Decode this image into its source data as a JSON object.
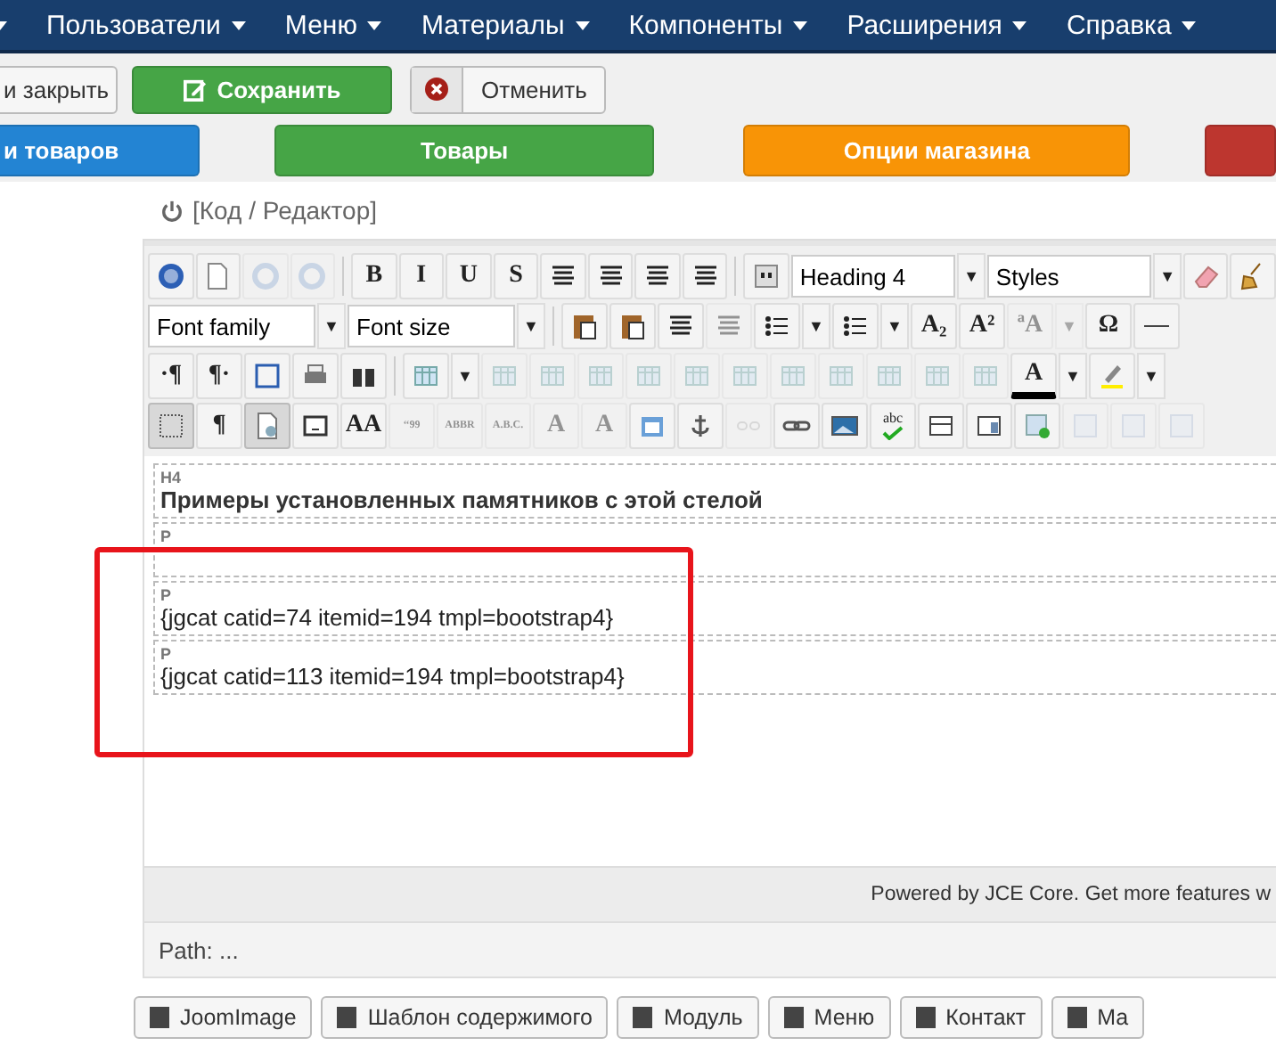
{
  "navbar": {
    "items": [
      {
        "has_menu": true
      },
      {
        "label": "Пользователи",
        "has_menu": true
      },
      {
        "label": "Меню",
        "has_menu": true
      },
      {
        "label": "Материалы",
        "has_menu": true
      },
      {
        "label": "Компоненты",
        "has_menu": true
      },
      {
        "label": "Расширения",
        "has_menu": true
      },
      {
        "label": "Справка",
        "has_menu": true
      }
    ]
  },
  "actions": [
    {
      "kind": "plain",
      "label": "и закрыть"
    },
    {
      "kind": "save",
      "label": "Сохранить"
    },
    {
      "kind": "cancel",
      "label": "Отменить"
    }
  ],
  "tabs": [
    {
      "label": "и товаров",
      "color": "#2384d3"
    },
    {
      "label": "Товары",
      "color": "#46a546"
    },
    {
      "label": "Опции магазина",
      "color": "#f89406"
    },
    {
      "color": "#bd362f"
    }
  ],
  "editor": {
    "toggle_label": "[Код / Редактор]",
    "toolbar": [
      [
        {
          "kind": "icon",
          "disabled": false,
          "pressed": false
        },
        {
          "kind": "icon",
          "disabled": false,
          "pressed": false
        },
        {
          "kind": "icon",
          "disabled": true,
          "pressed": false
        },
        {
          "kind": "icon",
          "disabled": true,
          "pressed": false
        },
        {
          "kind": "separator"
        },
        {
          "kind": "glyph",
          "text": "B",
          "disabled": false,
          "pressed": false
        },
        {
          "kind": "glyph",
          "text": "I",
          "disabled": false,
          "pressed": false
        },
        {
          "kind": "glyph",
          "text": "U",
          "disabled": false,
          "pressed": false
        },
        {
          "kind": "glyph",
          "text": "S",
          "disabled": false,
          "pressed": false
        },
        {
          "kind": "icon",
          "disabled": false,
          "pressed": false
        },
        {
          "kind": "icon",
          "disabled": false,
          "pressed": false
        },
        {
          "kind": "icon",
          "disabled": false,
          "pressed": false
        },
        {
          "kind": "icon",
          "disabled": false,
          "pressed": false
        },
        {
          "kind": "separator"
        },
        {
          "kind": "icon",
          "disabled": false,
          "pressed": false
        },
        {
          "kind": "select",
          "label": "Heading 4"
        },
        {
          "kind": "arrow",
          "text": "▼",
          "disabled": false
        },
        {
          "kind": "select",
          "label": "Styles"
        },
        {
          "kind": "arrow",
          "text": "▼",
          "disabled": false
        },
        {
          "kind": "icon",
          "disabled": false,
          "pressed": false
        },
        {
          "kind": "icon",
          "disabled": false,
          "pressed": false
        }
      ],
      [
        {
          "kind": "select",
          "label": "Font family"
        },
        {
          "kind": "arrow",
          "text": "▼",
          "disabled": false
        },
        {
          "kind": "select",
          "label": "Font size"
        },
        {
          "kind": "arrow",
          "text": "▼",
          "disabled": false
        },
        {
          "kind": "separator"
        },
        {
          "kind": "icon",
          "disabled": false,
          "pressed": false
        },
        {
          "kind": "icon",
          "disabled": false,
          "pressed": false
        },
        {
          "kind": "icon",
          "disabled": false,
          "pressed": false
        },
        {
          "kind": "icon",
          "disabled": true,
          "pressed": false
        },
        {
          "kind": "icon",
          "disabled": false,
          "pressed": false
        },
        {
          "kind": "arrow",
          "text": "▼",
          "disabled": false
        },
        {
          "kind": "icon",
          "disabled": false,
          "pressed": false
        },
        {
          "kind": "arrow",
          "text": "▼",
          "disabled": false
        },
        {
          "kind": "glyph",
          "text": "A₂",
          "disabled": false,
          "pressed": false
        },
        {
          "kind": "glyph",
          "text": "A²",
          "disabled": false,
          "pressed": false
        },
        {
          "kind": "glyph",
          "text": "ªA",
          "disabled": true,
          "pressed": false
        },
        {
          "kind": "arrow",
          "text": "▼",
          "disabled": true
        },
        {
          "kind": "glyph",
          "text": "Ω",
          "disabled": false,
          "pressed": false
        },
        {
          "kind": "icon",
          "disabled": false,
          "pressed": false
        }
      ],
      [
        {
          "kind": "glyph",
          "text": "·¶",
          "disabled": false,
          "pressed": false
        },
        {
          "kind": "glyph",
          "text": "¶·",
          "disabled": false,
          "pressed": false
        },
        {
          "kind": "icon",
          "disabled": false,
          "pressed": false
        },
        {
          "kind": "icon",
          "disabled": false,
          "pressed": false
        },
        {
          "kind": "icon",
          "disabled": false,
          "pressed": false
        },
        {
          "kind": "separator"
        },
        {
          "kind": "icon",
          "disabled": false,
          "pressed": false
        },
        {
          "kind": "arrow",
          "text": "▼",
          "disabled": false
        },
        {
          "kind": "icon",
          "disabled": true,
          "pressed": false
        },
        {
          "kind": "icon",
          "disabled": true,
          "pressed": false
        },
        {
          "kind": "icon",
          "disabled": true,
          "pressed": false
        },
        {
          "kind": "icon",
          "disabled": true,
          "pressed": false
        },
        {
          "kind": "icon",
          "disabled": true,
          "pressed": false
        },
        {
          "kind": "icon",
          "disabled": true,
          "pressed": false
        },
        {
          "kind": "icon",
          "disabled": true,
          "pressed": false
        },
        {
          "kind": "icon",
          "disabled": true,
          "pressed": false
        },
        {
          "kind": "icon",
          "disabled": true,
          "pressed": false
        },
        {
          "kind": "icon",
          "disabled": true,
          "pressed": false
        },
        {
          "kind": "icon",
          "disabled": true,
          "pressed": false
        },
        {
          "kind": "color-glyph",
          "text": "A",
          "color": "#000000",
          "disabled": false,
          "pressed": false
        },
        {
          "kind": "arrow",
          "text": "▼",
          "disabled": false
        },
        {
          "kind": "icon",
          "disabled": false,
          "pressed": false
        },
        {
          "kind": "arrow",
          "text": "▼",
          "disabled": false
        }
      ],
      [
        {
          "kind": "icon",
          "disabled": false,
          "pressed": true
        },
        {
          "kind": "glyph",
          "text": "¶",
          "disabled": false,
          "pressed": false
        },
        {
          "kind": "icon",
          "disabled": false,
          "pressed": true
        },
        {
          "kind": "icon",
          "disabled": false,
          "pressed": false
        },
        {
          "kind": "glyph",
          "text": "AA",
          "disabled": false,
          "pressed": false
        },
        {
          "kind": "glyph",
          "text": "‘‘99",
          "disabled": true,
          "pressed": false
        },
        {
          "kind": "glyph",
          "text": "ABBR",
          "disabled": true,
          "pressed": false
        },
        {
          "kind": "glyph",
          "text": "A.B.C.",
          "disabled": true,
          "pressed": false
        },
        {
          "kind": "glyph",
          "text": "A",
          "disabled": true,
          "pressed": false
        },
        {
          "kind": "glyph",
          "text": "A",
          "disabled": true,
          "pressed": false
        },
        {
          "kind": "icon",
          "disabled": false,
          "pressed": false
        },
        {
          "kind": "icon",
          "disabled": false,
          "pressed": false
        },
        {
          "kind": "icon",
          "disabled": true,
          "pressed": false
        },
        {
          "kind": "icon",
          "disabled": false,
          "pressed": false
        },
        {
          "kind": "icon",
          "disabled": false,
          "pressed": false
        },
        {
          "kind": "glyph-check",
          "text": "abc",
          "disabled": false,
          "pressed": false
        },
        {
          "kind": "icon",
          "disabled": false,
          "pressed": false
        },
        {
          "kind": "icon",
          "disabled": false,
          "pressed": false
        },
        {
          "kind": "icon",
          "disabled": false,
          "pressed": false
        },
        {
          "kind": "icon",
          "disabled": true,
          "pressed": false
        },
        {
          "kind": "icon",
          "disabled": true,
          "pressed": false
        },
        {
          "kind": "icon",
          "disabled": true,
          "pressed": false
        }
      ]
    ],
    "blocks": [
      {
        "tag": "H4",
        "text": "Примеры установленных памятников с этой стелой",
        "kind": "heading"
      },
      {
        "tag": "P",
        "kind": "paragraph"
      },
      {
        "tag": "P",
        "text": "{jgcat catid=74 itemid=194 tmpl=bootstrap4}",
        "kind": "paragraph"
      },
      {
        "tag": "P",
        "text": "{jgcat catid=113 itemid=194 tmpl=bootstrap4}",
        "kind": "paragraph"
      }
    ],
    "powered": "Powered by JCE Core. Get more features w",
    "path": "Path: ..."
  },
  "insert_buttons": [
    {
      "label": "JoomImage"
    },
    {
      "label": "Шаблон содержимого"
    },
    {
      "label": "Модуль"
    },
    {
      "label": "Меню"
    },
    {
      "label": "Контакт"
    },
    {
      "label": "Ма"
    }
  ]
}
